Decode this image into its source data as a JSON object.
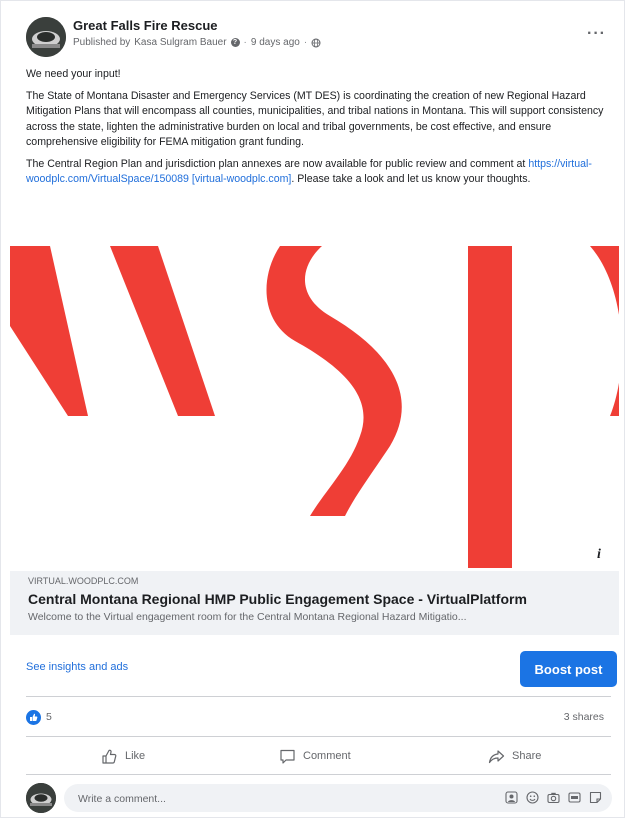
{
  "post": {
    "page_name": "Great Falls Fire Rescue",
    "published_by_prefix": "Published by",
    "published_by_name": "Kasa Sulgram Bauer",
    "time_ago": "9 days ago",
    "paragraphs": {
      "p1": "We need your input!",
      "p2": "The State of Montana Disaster and Emergency Services (MT DES) is coordinating the creation of new Regional Hazard Mitigation Plans that will encompass all counties, municipalities, and tribal nations in Montana. This will support consistency across the state, lighten the administrative burden on local and tribal governments, be cost effective, and ensure comprehensive eligibility for FEMA mitigation grant funding.",
      "p3_before": "The Central Region Plan and jurisdiction plan annexes are now available for public review and comment at ",
      "p3_link": "https://virtual-woodplc.com/VirtualSpace/150089 [virtual-woodplc.com]",
      "p3_after": ".  Please take a look and let us know your thoughts."
    },
    "colors": {
      "accent": "#1b74e4",
      "brand_red": "#ef3e36",
      "link": "#216fdb"
    },
    "icons": {
      "more": "more-dots-icon",
      "globe": "globe-icon",
      "info": "info-icon"
    }
  },
  "link_preview": {
    "domain": "VIRTUAL.WOODPLC.COM",
    "title": "Central Montana Regional HMP Public Engagement Space - VirtualPlatform",
    "description": "Welcome to the Virtual engagement room for the Central Montana Regional Hazard Mitigatio..."
  },
  "insights": {
    "link_label": "See insights and ads",
    "boost_label": "Boost post"
  },
  "engagement": {
    "reaction_count": "5",
    "shares": "3 shares"
  },
  "actions": {
    "like": "Like",
    "comment": "Comment",
    "share": "Share"
  },
  "comment": {
    "placeholder": "Write a comment..."
  }
}
